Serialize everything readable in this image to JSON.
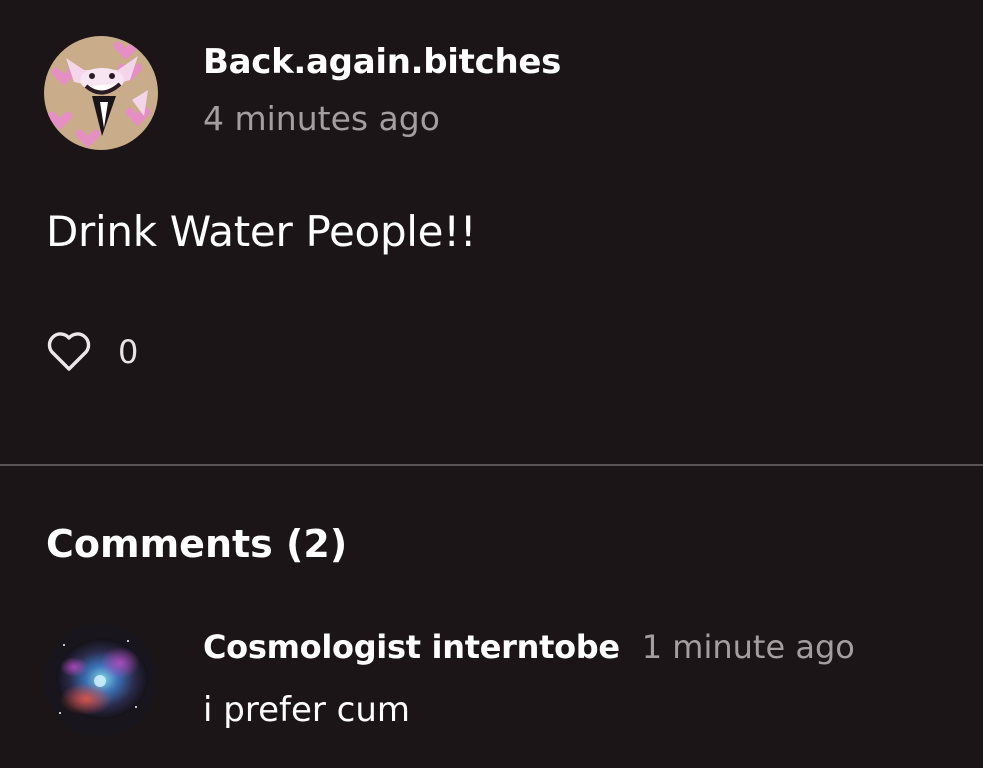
{
  "post": {
    "author": "Back.again.bitches",
    "time": "4 minutes ago",
    "body": "Drink Water People!!",
    "like_count": "0",
    "avatar_icon": "profile-avatar"
  },
  "comments_section": {
    "heading": "Comments (2)",
    "items": [
      {
        "author": "Cosmologist interntobe",
        "time": "1 minute ago",
        "text": "i prefer cum",
        "avatar_icon": "nebula-avatar"
      }
    ]
  },
  "colors": {
    "background": "#1b1517",
    "text_primary": "#ffffff",
    "text_secondary": "#a49ea1",
    "divider": "#5b5457"
  }
}
